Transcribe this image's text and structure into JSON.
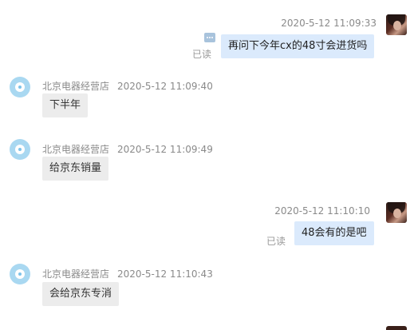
{
  "messages": [
    {
      "dir": "out",
      "time": "2020-5-12 11:09:33",
      "text": "再问下今年cx的48寸会进货吗",
      "read": "已读"
    },
    {
      "dir": "in",
      "sender": "北京电器经营店",
      "time": "2020-5-12 11:09:40",
      "text": "下半年"
    },
    {
      "dir": "in",
      "sender": "北京电器经营店",
      "time": "2020-5-12 11:09:49",
      "text": "给京东销量"
    },
    {
      "dir": "out",
      "time": "2020-5-12 11:10:10",
      "text": "48会有的是吧",
      "read": "已读"
    },
    {
      "dir": "in",
      "sender": "北京电器经营店",
      "time": "2020-5-12 11:10:43",
      "text": "会给京东专消"
    }
  ],
  "icons": {
    "self_avatar": "user-avatar-icon",
    "shop_avatar": "shop-avatar-icon",
    "more": "more-options-icon"
  },
  "colors": {
    "outgoing_bubble": "#dbeafc",
    "incoming_bubble": "#ececec",
    "meta_text": "#8a8a8a",
    "shop_avatar": "#a9d8f1"
  }
}
